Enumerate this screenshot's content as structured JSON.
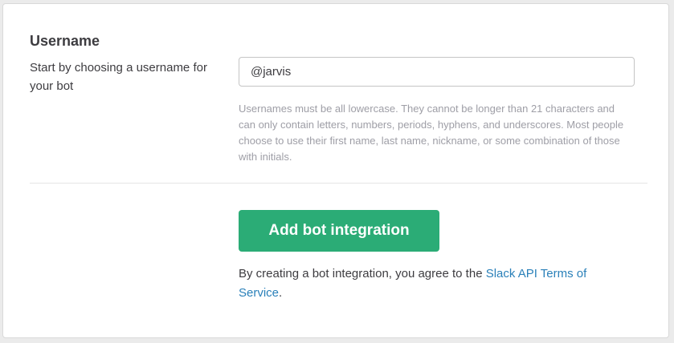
{
  "username_section": {
    "title": "Username",
    "description": "Start by choosing a username for your bot",
    "input_value": "@jarvis",
    "hint": "Usernames must be all lowercase. They cannot be longer than 21 characters and can only contain letters, numbers, periods, hyphens, and underscores. Most people choose to use their first name, last name, nickname, or some combination of those with initials."
  },
  "actions": {
    "add_button_label": "Add bot integration",
    "terms_prefix": "By creating a bot integration, you agree to the ",
    "terms_link": "Slack API Terms of Service",
    "terms_suffix": "."
  },
  "colors": {
    "button_green": "#2bac76",
    "link_blue": "#2a80b9",
    "hint_gray": "#9e9ea6",
    "text_dark": "#3d3c40"
  }
}
